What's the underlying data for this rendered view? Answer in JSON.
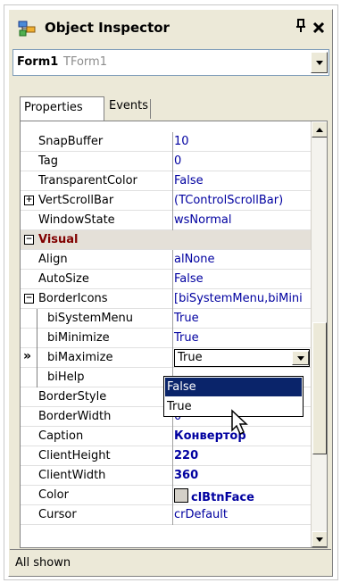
{
  "window": {
    "title": "Object Inspector",
    "pin_glyph": "ɹ",
    "close_glyph": "✕",
    "icon": "object-inspector-icon"
  },
  "component_selector": {
    "name": "Form1",
    "type": "TForm1"
  },
  "tabs": [
    {
      "label": "Properties",
      "active": true
    },
    {
      "label": "Events",
      "active": false
    }
  ],
  "properties": [
    {
      "name": "SnapBuffer",
      "value": "10"
    },
    {
      "name": "Tag",
      "value": "0"
    },
    {
      "name": "TransparentColor",
      "value": "False"
    },
    {
      "name": "VertScrollBar",
      "value": "(TControlScrollBar)",
      "expander": "+"
    },
    {
      "name": "WindowState",
      "value": "wsNormal"
    },
    {
      "name": "Visual",
      "category": true,
      "expander": "−"
    },
    {
      "name": "Align",
      "value": "alNone"
    },
    {
      "name": "AutoSize",
      "value": "False"
    },
    {
      "name": "BorderIcons",
      "value": "[biSystemMenu,biMini",
      "expander": "−"
    },
    {
      "name": "biSystemMenu",
      "value": "True",
      "sub": true
    },
    {
      "name": "biMinimize",
      "value": "True",
      "sub": true
    },
    {
      "name": "biMaximize",
      "value": "True",
      "sub": true,
      "active": true
    },
    {
      "name": "biHelp",
      "value": "",
      "sub": true
    },
    {
      "name": "BorderStyle",
      "value": ""
    },
    {
      "name": "BorderWidth",
      "value": "0"
    },
    {
      "name": "Caption",
      "value": "Конвертор",
      "bold": true
    },
    {
      "name": "ClientHeight",
      "value": "220",
      "bold": true
    },
    {
      "name": "ClientWidth",
      "value": "360",
      "bold": true
    },
    {
      "name": "Color",
      "value": "clBtnFace",
      "bold": true,
      "swatch": "#d4d0c8"
    },
    {
      "name": "Cursor",
      "value": "crDefault"
    }
  ],
  "active_marker": "»",
  "dropdown_options": [
    {
      "label": "False",
      "selected": true
    },
    {
      "label": "True",
      "selected": false
    }
  ],
  "status": {
    "text": "All shown"
  },
  "colors": {
    "value_text": "#0000a0",
    "category_text": "#800000",
    "selection": "#0a246a",
    "panel": "#ece9d8"
  }
}
